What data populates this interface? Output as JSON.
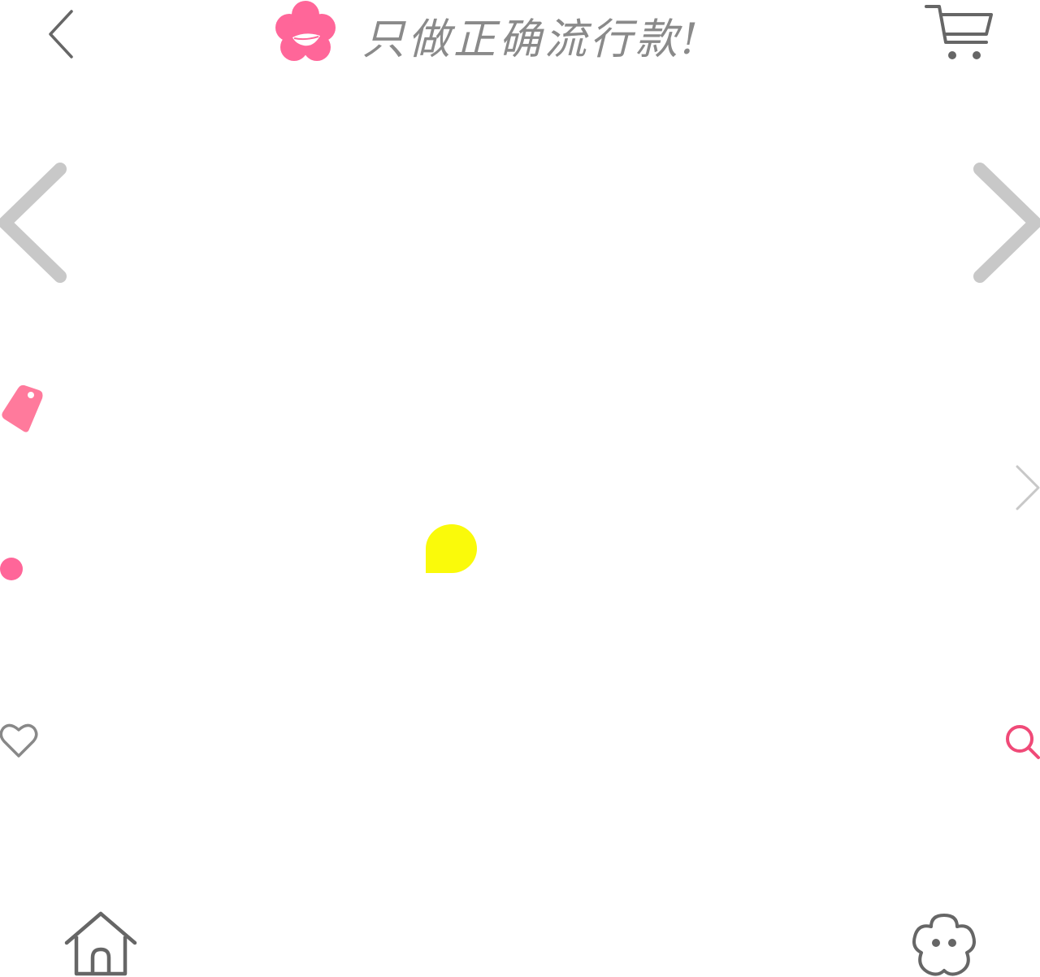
{
  "header": {
    "slogan": "只做正确流行款!",
    "icons": {
      "back": "chevron-left-icon",
      "logo": "flower-lips-logo",
      "cart": "shopping-cart-icon"
    }
  },
  "carousel": {
    "prev_icon": "chevron-left-icon",
    "next_icon": "chevron-right-icon"
  },
  "floating_icons": {
    "tag": "price-tag-icon",
    "small_next": "chevron-right-icon",
    "dot": "pink-dot-icon",
    "chat_bubble": "chat-bubble-icon",
    "favorite": "heart-icon",
    "search": "search-icon"
  },
  "bottom_nav": {
    "home_icon": "home-icon",
    "profile_icon": "flower-face-icon"
  },
  "colors": {
    "brand_pink": "#ff6699",
    "tag_pink": "#ff7a9c",
    "search_pink": "#f04a78",
    "bubble_yellow": "#fafa0a",
    "icon_gray": "#666666",
    "arrow_gray": "#c8c8c8",
    "slogan_gray": "#8a8a8a"
  }
}
